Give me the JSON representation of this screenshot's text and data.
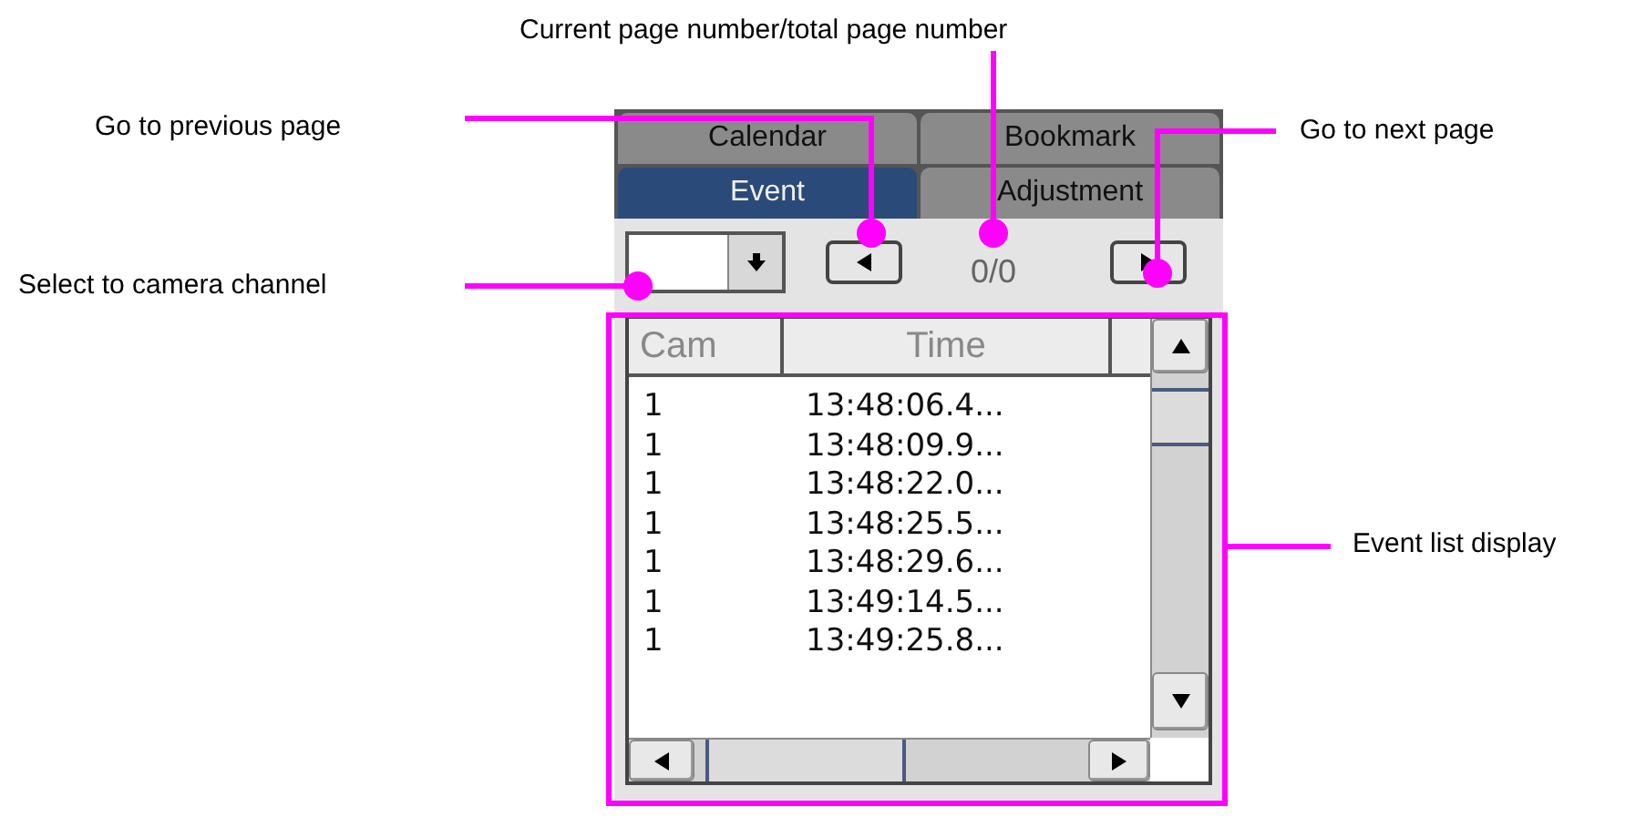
{
  "callouts": [
    {
      "text": "Current page number/total page number"
    },
    {
      "text": "Go to previous page"
    },
    {
      "text": "Go to next page"
    },
    {
      "text": "Select to camera channel"
    },
    {
      "text": "Event list display"
    }
  ],
  "tabs": [
    {
      "label": "Calendar",
      "selected": false
    },
    {
      "label": "Bookmark",
      "selected": false
    },
    {
      "label": "Event",
      "selected": true
    },
    {
      "label": "Adjustment",
      "selected": false
    }
  ],
  "page_indicator": "0/0",
  "table": {
    "columns": [
      "Cam",
      "Time"
    ],
    "rows": [
      [
        "1",
        "13:48:06.4..."
      ],
      [
        "1",
        "13:48:09.9..."
      ],
      [
        "1",
        "13:48:22.0..."
      ],
      [
        "1",
        "13:48:25.5..."
      ],
      [
        "1",
        "13:48:29.6..."
      ],
      [
        "1",
        "13:49:14.5..."
      ],
      [
        "1",
        "13:49:25.8..."
      ]
    ]
  }
}
